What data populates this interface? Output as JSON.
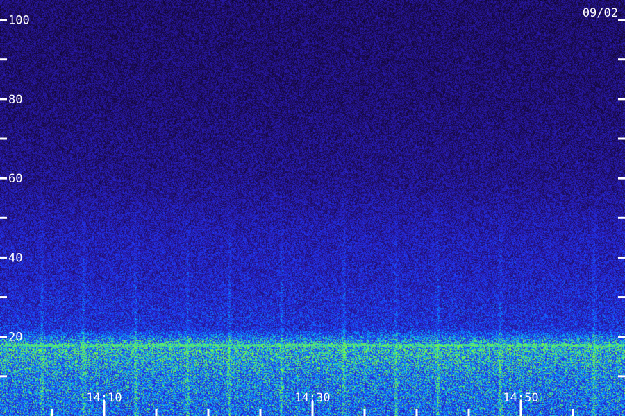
{
  "chart_data": {
    "type": "heatmap",
    "title": "",
    "date": "09/02",
    "xlabel": "",
    "ylabel": "",
    "ylim": [
      0,
      105
    ],
    "xlim": [
      "14:00",
      "15:00"
    ],
    "y_tick_labels": [
      "100",
      "80",
      "60",
      "40",
      "20"
    ],
    "y_tick_values": [
      100,
      80,
      60,
      40,
      20
    ],
    "y_minor_tick_values": [
      90,
      70,
      50,
      30,
      10
    ],
    "x_tick_labels": [
      "14:10",
      "14:30",
      "14:50"
    ],
    "x_tick_values": [
      "14:10",
      "14:30",
      "14:50"
    ],
    "x_minor_tick_values": [
      "14:05",
      "14:15",
      "14:20",
      "14:25",
      "14:35",
      "14:40",
      "14:45",
      "14:55"
    ],
    "colormap": [
      "#000000",
      "#1a0a4a",
      "#2a1ab0",
      "#1e3cff",
      "#00b4ff",
      "#7dff3c"
    ],
    "intensity_profile": [
      {
        "y": 100,
        "level": 0.18
      },
      {
        "y": 80,
        "level": 0.2
      },
      {
        "y": 60,
        "level": 0.26
      },
      {
        "y": 45,
        "level": 0.38
      },
      {
        "y": 35,
        "level": 0.42
      },
      {
        "y": 22,
        "level": 0.5
      },
      {
        "y": 18,
        "level": 0.9
      },
      {
        "y": 10,
        "level": 0.72
      },
      {
        "y": 2,
        "level": 0.65
      }
    ],
    "bright_band_y": 18,
    "vertical_streaks_x": [
      "14:04",
      "14:08",
      "14:13",
      "14:18",
      "14:22",
      "14:27",
      "14:33",
      "14:38",
      "14:42",
      "14:48",
      "14:57"
    ]
  }
}
